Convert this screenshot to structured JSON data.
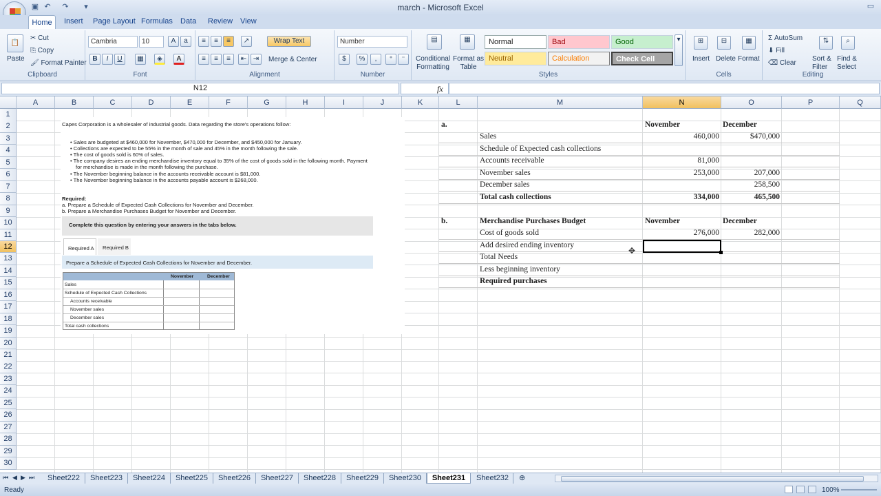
{
  "window": {
    "title": "march - Microsoft Excel"
  },
  "ribbon_tabs": [
    "Home",
    "Insert",
    "Page Layout",
    "Formulas",
    "Data",
    "Review",
    "View"
  ],
  "ribbon": {
    "clipboard": {
      "paste": "Paste",
      "cut": "Cut",
      "copy": "Copy",
      "format_painter": "Format Painter",
      "label": "Clipboard"
    },
    "font": {
      "name": "Cambria",
      "size": "10",
      "label": "Font",
      "bold": "B",
      "italic": "I",
      "underline": "U"
    },
    "alignment": {
      "wrap_text": "Wrap Text",
      "merge_center": "Merge & Center",
      "label": "Alignment"
    },
    "number": {
      "format": "Number",
      "currency": "$",
      "percent": "%",
      "comma": ",",
      "label": "Number"
    },
    "styles": {
      "conditional_formatting": "Conditional\nFormatting",
      "format_as_table": "Format as\nTable",
      "normal": "Normal",
      "bad": "Bad",
      "good": "Good",
      "neutral": "Neutral",
      "calculation": "Calculation",
      "check_cell": "Check Cell",
      "label": "Styles"
    },
    "cells": {
      "insert": "Insert",
      "delete": "Delete",
      "format": "Format",
      "label": "Cells"
    },
    "editing": {
      "autosum": "AutoSum",
      "fill": "Fill",
      "clear": "Clear",
      "sort_filter": "Sort &\nFilter",
      "find_select": "Find &\nSelect",
      "label": "Editing"
    }
  },
  "formula_bar": {
    "name_box": "N12",
    "fx": "fx",
    "value": ""
  },
  "columns": [
    "A",
    "B",
    "C",
    "D",
    "E",
    "F",
    "G",
    "H",
    "I",
    "J",
    "K",
    "L",
    "M",
    "N",
    "O",
    "P",
    "Q"
  ],
  "rows": [
    "1",
    "2",
    "3",
    "4",
    "5",
    "6",
    "7",
    "8",
    "9",
    "10",
    "11",
    "12",
    "13",
    "14",
    "15",
    "16",
    "17",
    "18",
    "19",
    "20",
    "21",
    "22",
    "23",
    "24",
    "25",
    "26",
    "27",
    "28",
    "29",
    "30"
  ],
  "problem": {
    "intro": "Capes Corporation is a wholesaler of industrial goods. Data regarding the store's operations follow:",
    "bullets": [
      "Sales are budgeted at $460,000 for November, $470,000 for December, and $450,000 for January.",
      "Collections are expected to be 55% in the month of sale and 45% in the month following the sale.",
      "The cost of goods sold is 60% of sales.",
      "The company desires an ending merchandise inventory equal to 35% of the cost of goods sold in the following month. Payment",
      "for merchandise is made in the month following the purchase.",
      "The November beginning balance in the accounts receivable account is $81,000.",
      "The November beginning balance in the accounts payable account is $268,000."
    ],
    "required_title": "Required:",
    "required_a": "a. Prepare a Schedule of Expected Cash Collections for November and December.",
    "required_b": "b. Prepare a Merchandise Purchases Budget for November and December.",
    "instruction": "Complete this question by entering your answers in the tabs below.",
    "tab_a": "Required A",
    "tab_b": "Required B",
    "prompt": "Prepare a Schedule of Expected Cash Collections for November and December.",
    "table_headers": [
      "November",
      "December"
    ],
    "table_rows": [
      "Sales",
      "Schedule of Expected Cash Collections",
      "Accounts receivable",
      "November sales",
      "December sales",
      "Total cash collections"
    ]
  },
  "section_a": {
    "label": "a.",
    "col_nov": "November",
    "col_dec": "December",
    "rows": [
      {
        "label": "Sales",
        "nov": "460,000",
        "dec": "$470,000"
      },
      {
        "label": "Schedule of Expected cash collections",
        "nov": "",
        "dec": ""
      },
      {
        "label": "Accounts receivable",
        "nov": "81,000",
        "dec": ""
      },
      {
        "label": "November sales",
        "nov": "253,000",
        "dec": "207,000"
      },
      {
        "label": "December sales",
        "nov": "",
        "dec": "258,500"
      },
      {
        "label": "Total cash collections",
        "nov": "334,000",
        "dec": "465,500"
      }
    ]
  },
  "section_b": {
    "label": "b.",
    "title": "Merchandise Purchases Budget",
    "col_nov": "November",
    "col_dec": "December",
    "rows": [
      {
        "label": "Cost of goods sold",
        "nov": "276,000",
        "dec": "282,000"
      },
      {
        "label": "Add desired ending inventory",
        "nov": "",
        "dec": ""
      },
      {
        "label": "Total Needs",
        "nov": "",
        "dec": ""
      },
      {
        "label": "Less beginning inventory",
        "nov": "",
        "dec": ""
      },
      {
        "label": "Required purchases",
        "nov": "",
        "dec": ""
      }
    ]
  },
  "sheet_tabs": [
    "Sheet222",
    "Sheet223",
    "Sheet224",
    "Sheet225",
    "Sheet226",
    "Sheet227",
    "Sheet228",
    "Sheet229",
    "Sheet230",
    "Sheet231",
    "Sheet232"
  ],
  "active_sheet": "Sheet231",
  "status": {
    "ready": "Ready",
    "zoom": "100%"
  }
}
